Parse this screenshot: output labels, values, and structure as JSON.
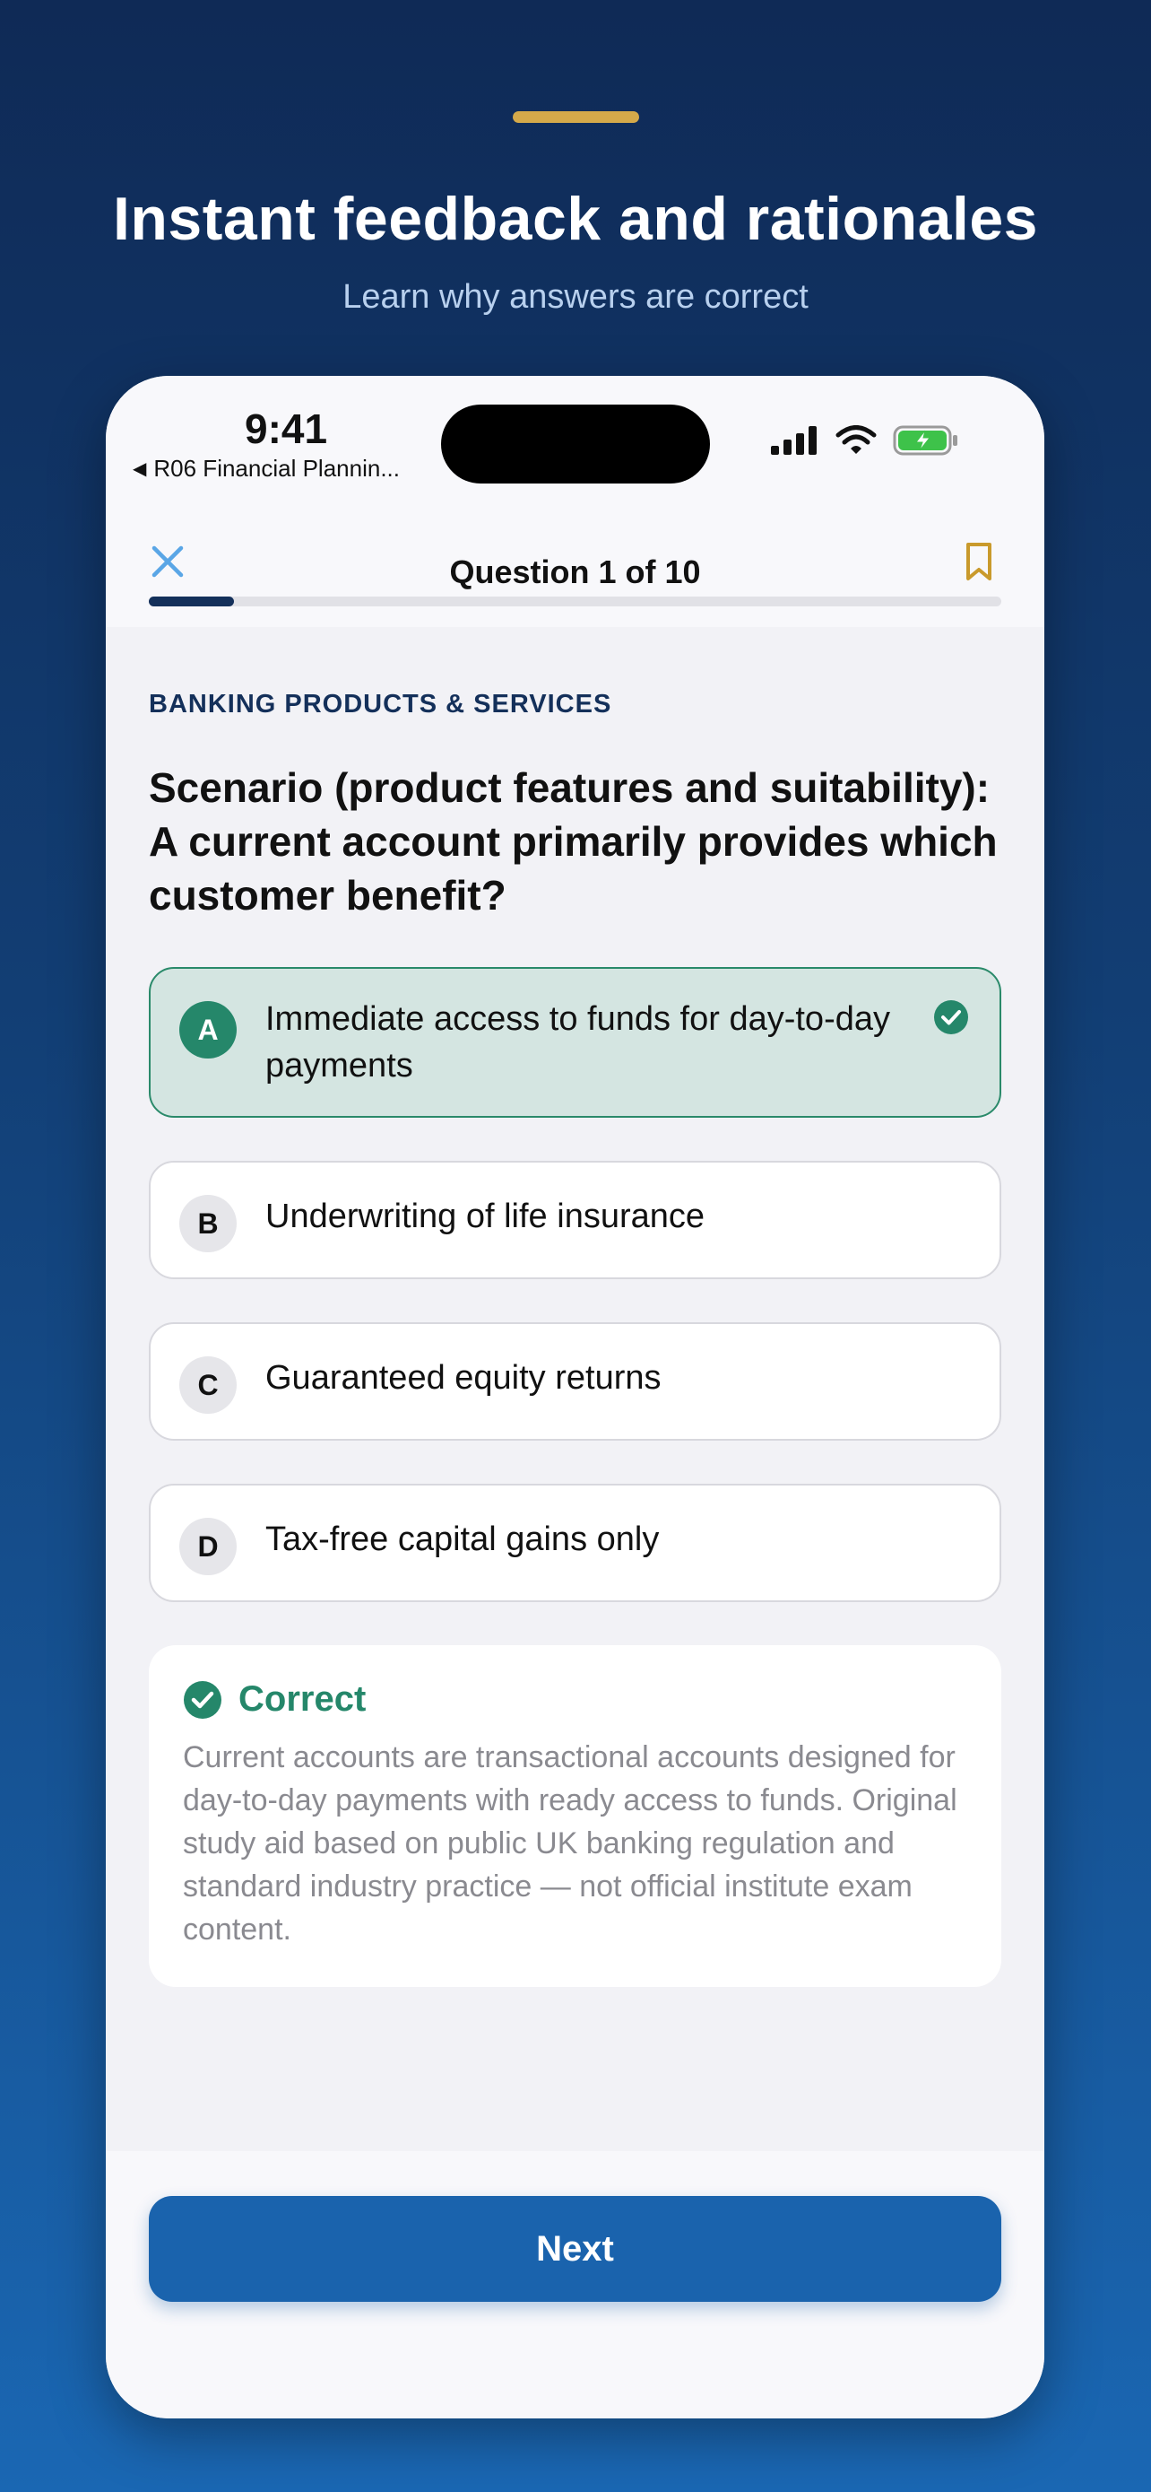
{
  "hero": {
    "title": "Instant feedback and rationales",
    "subtitle": "Learn why answers are correct"
  },
  "status_bar": {
    "time": "9:41",
    "back_app": "R06 Financial Plannin..."
  },
  "nav": {
    "title": "Question 1 of 10",
    "progress": 0.1
  },
  "question": {
    "category": "BANKING PRODUCTS & SERVICES",
    "text": "Scenario (product features and suitability): A current account primarily provides which customer benefit?",
    "options": [
      {
        "letter": "A",
        "text": "Immediate access to funds for day-to-day payments",
        "state": "correct"
      },
      {
        "letter": "B",
        "text": "Underwriting of life insurance",
        "state": "default"
      },
      {
        "letter": "C",
        "text": "Guaranteed equity returns",
        "state": "default"
      },
      {
        "letter": "D",
        "text": "Tax-free capital gains only",
        "state": "default"
      }
    ]
  },
  "feedback": {
    "title": "Correct",
    "body": "Current accounts are transactional accounts designed for day-to-day payments with ready access to funds. Original study aid based on public UK banking regulation and standard industry practice — not official institute exam content."
  },
  "footer": {
    "next_label": "Next"
  },
  "colors": {
    "accent": "#d4a94a",
    "primary": "#1a63ad",
    "navy": "#14305a",
    "success": "#25876a"
  }
}
